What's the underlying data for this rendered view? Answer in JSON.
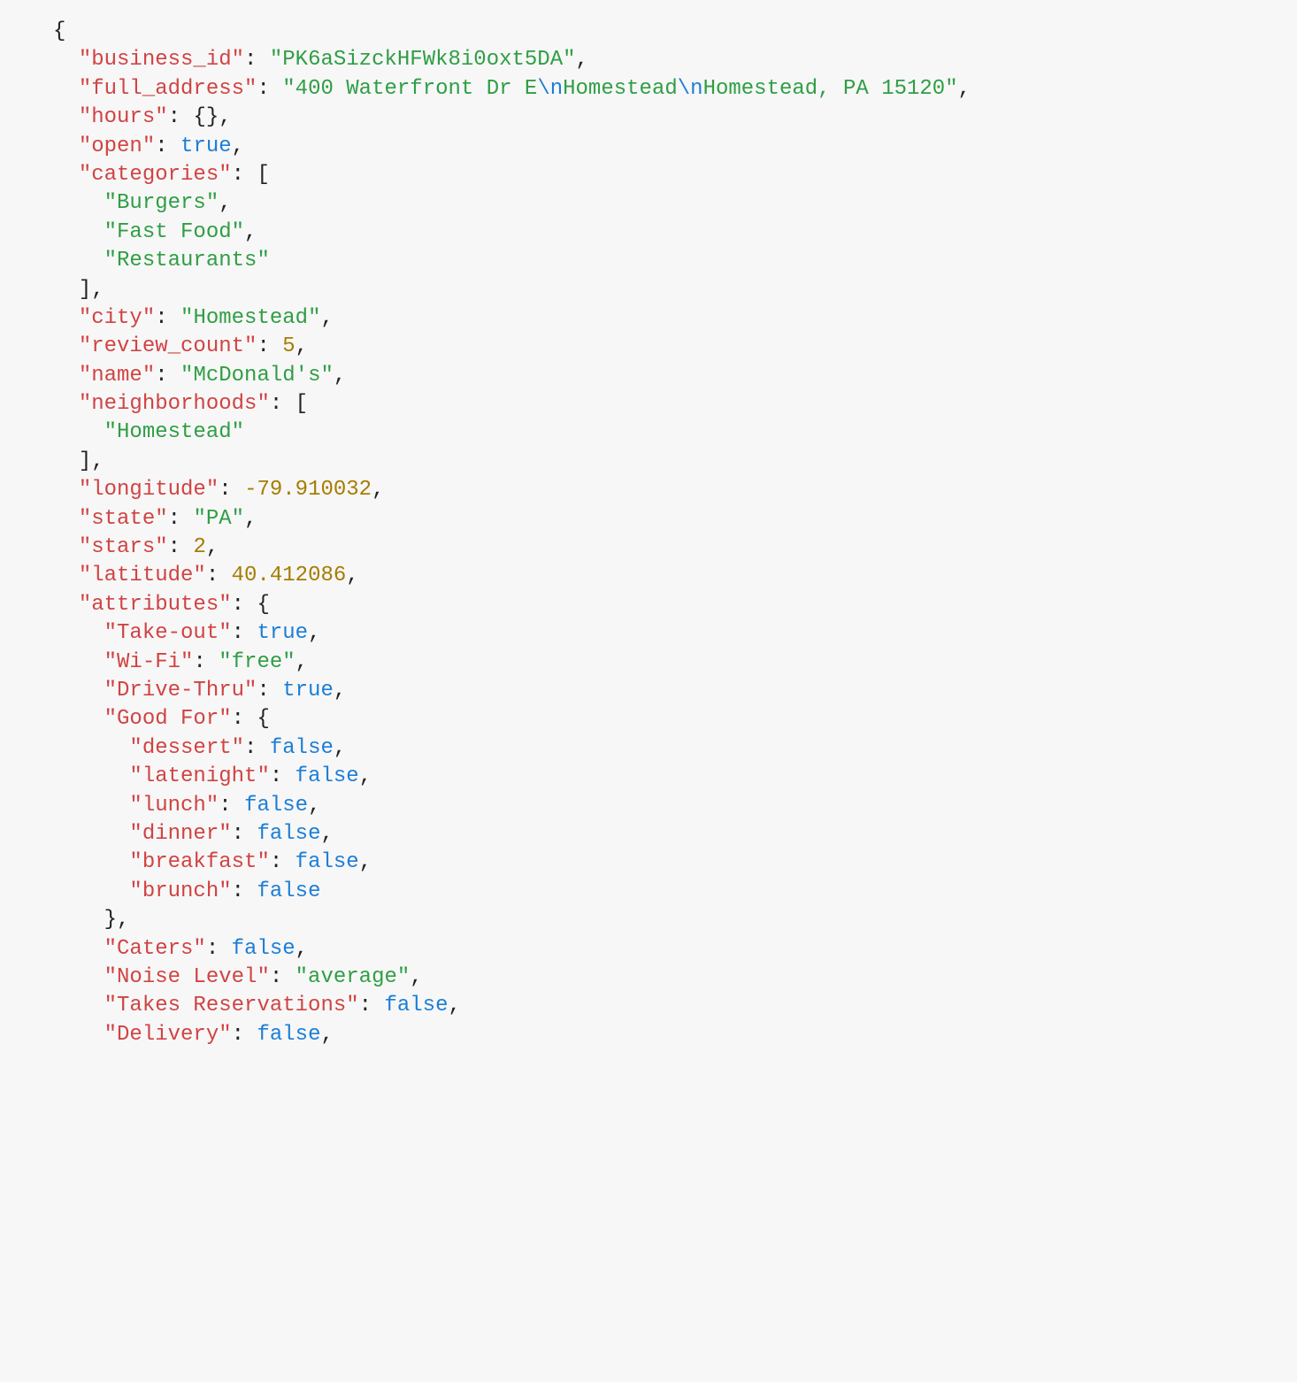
{
  "tokens": [
    {
      "cls": "p",
      "txt": "{"
    },
    {
      "nl": true,
      "indent": 1,
      "cls": "k",
      "txt": "\"business_id\""
    },
    {
      "cls": "p",
      "txt": ": "
    },
    {
      "cls": "s",
      "txt": "\"PK6aSizckHFWk8i0oxt5DA\""
    },
    {
      "cls": "p",
      "txt": ","
    },
    {
      "nl": true,
      "indent": 1,
      "cls": "k",
      "txt": "\"full_address\""
    },
    {
      "cls": "p",
      "txt": ": "
    },
    {
      "cls": "s",
      "txt": "\"400 Waterfront Dr E"
    },
    {
      "cls": "e",
      "txt": "\\n"
    },
    {
      "cls": "s",
      "txt": "Homestead"
    },
    {
      "cls": "e",
      "txt": "\\n"
    },
    {
      "cls": "s",
      "txt": "Homestead, PA 15120\""
    },
    {
      "cls": "p",
      "txt": ","
    },
    {
      "nl": true,
      "indent": 1,
      "cls": "k",
      "txt": "\"hours\""
    },
    {
      "cls": "p",
      "txt": ": {},"
    },
    {
      "nl": true,
      "indent": 1,
      "cls": "k",
      "txt": "\"open\""
    },
    {
      "cls": "p",
      "txt": ": "
    },
    {
      "cls": "b",
      "txt": "true"
    },
    {
      "cls": "p",
      "txt": ","
    },
    {
      "nl": true,
      "indent": 1,
      "cls": "k",
      "txt": "\"categories\""
    },
    {
      "cls": "p",
      "txt": ": ["
    },
    {
      "nl": true,
      "indent": 2,
      "cls": "s",
      "txt": "\"Burgers\""
    },
    {
      "cls": "p",
      "txt": ","
    },
    {
      "nl": true,
      "indent": 2,
      "cls": "s",
      "txt": "\"Fast Food\""
    },
    {
      "cls": "p",
      "txt": ","
    },
    {
      "nl": true,
      "indent": 2,
      "cls": "s",
      "txt": "\"Restaurants\""
    },
    {
      "nl": true,
      "indent": 1,
      "cls": "p",
      "txt": "],"
    },
    {
      "nl": true,
      "indent": 1,
      "cls": "k",
      "txt": "\"city\""
    },
    {
      "cls": "p",
      "txt": ": "
    },
    {
      "cls": "s",
      "txt": "\"Homestead\""
    },
    {
      "cls": "p",
      "txt": ","
    },
    {
      "nl": true,
      "indent": 1,
      "cls": "k",
      "txt": "\"review_count\""
    },
    {
      "cls": "p",
      "txt": ": "
    },
    {
      "cls": "n",
      "txt": "5"
    },
    {
      "cls": "p",
      "txt": ","
    },
    {
      "nl": true,
      "indent": 1,
      "cls": "k",
      "txt": "\"name\""
    },
    {
      "cls": "p",
      "txt": ": "
    },
    {
      "cls": "s",
      "txt": "\"McDonald's\""
    },
    {
      "cls": "p",
      "txt": ","
    },
    {
      "nl": true,
      "indent": 1,
      "cls": "k",
      "txt": "\"neighborhoods\""
    },
    {
      "cls": "p",
      "txt": ": ["
    },
    {
      "nl": true,
      "indent": 2,
      "cls": "s",
      "txt": "\"Homestead\""
    },
    {
      "nl": true,
      "indent": 1,
      "cls": "p",
      "txt": "],"
    },
    {
      "nl": true,
      "indent": 1,
      "cls": "k",
      "txt": "\"longitude\""
    },
    {
      "cls": "p",
      "txt": ": "
    },
    {
      "cls": "n",
      "txt": "-79.910032"
    },
    {
      "cls": "p",
      "txt": ","
    },
    {
      "nl": true,
      "indent": 1,
      "cls": "k",
      "txt": "\"state\""
    },
    {
      "cls": "p",
      "txt": ": "
    },
    {
      "cls": "s",
      "txt": "\"PA\""
    },
    {
      "cls": "p",
      "txt": ","
    },
    {
      "nl": true,
      "indent": 1,
      "cls": "k",
      "txt": "\"stars\""
    },
    {
      "cls": "p",
      "txt": ": "
    },
    {
      "cls": "n",
      "txt": "2"
    },
    {
      "cls": "p",
      "txt": ","
    },
    {
      "nl": true,
      "indent": 1,
      "cls": "k",
      "txt": "\"latitude\""
    },
    {
      "cls": "p",
      "txt": ": "
    },
    {
      "cls": "n",
      "txt": "40.412086"
    },
    {
      "cls": "p",
      "txt": ","
    },
    {
      "nl": true,
      "indent": 1,
      "cls": "k",
      "txt": "\"attributes\""
    },
    {
      "cls": "p",
      "txt": ": {"
    },
    {
      "nl": true,
      "indent": 2,
      "cls": "k",
      "txt": "\"Take-out\""
    },
    {
      "cls": "p",
      "txt": ": "
    },
    {
      "cls": "b",
      "txt": "true"
    },
    {
      "cls": "p",
      "txt": ","
    },
    {
      "nl": true,
      "indent": 2,
      "cls": "k",
      "txt": "\"Wi-Fi\""
    },
    {
      "cls": "p",
      "txt": ": "
    },
    {
      "cls": "s",
      "txt": "\"free\""
    },
    {
      "cls": "p",
      "txt": ","
    },
    {
      "nl": true,
      "indent": 2,
      "cls": "k",
      "txt": "\"Drive-Thru\""
    },
    {
      "cls": "p",
      "txt": ": "
    },
    {
      "cls": "b",
      "txt": "true"
    },
    {
      "cls": "p",
      "txt": ","
    },
    {
      "nl": true,
      "indent": 2,
      "cls": "k",
      "txt": "\"Good For\""
    },
    {
      "cls": "p",
      "txt": ": {"
    },
    {
      "nl": true,
      "indent": 3,
      "cls": "k",
      "txt": "\"dessert\""
    },
    {
      "cls": "p",
      "txt": ": "
    },
    {
      "cls": "b",
      "txt": "false"
    },
    {
      "cls": "p",
      "txt": ","
    },
    {
      "nl": true,
      "indent": 3,
      "cls": "k",
      "txt": "\"latenight\""
    },
    {
      "cls": "p",
      "txt": ": "
    },
    {
      "cls": "b",
      "txt": "false"
    },
    {
      "cls": "p",
      "txt": ","
    },
    {
      "nl": true,
      "indent": 3,
      "cls": "k",
      "txt": "\"lunch\""
    },
    {
      "cls": "p",
      "txt": ": "
    },
    {
      "cls": "b",
      "txt": "false"
    },
    {
      "cls": "p",
      "txt": ","
    },
    {
      "nl": true,
      "indent": 3,
      "cls": "k",
      "txt": "\"dinner\""
    },
    {
      "cls": "p",
      "txt": ": "
    },
    {
      "cls": "b",
      "txt": "false"
    },
    {
      "cls": "p",
      "txt": ","
    },
    {
      "nl": true,
      "indent": 3,
      "cls": "k",
      "txt": "\"breakfast\""
    },
    {
      "cls": "p",
      "txt": ": "
    },
    {
      "cls": "b",
      "txt": "false"
    },
    {
      "cls": "p",
      "txt": ","
    },
    {
      "nl": true,
      "indent": 3,
      "cls": "k",
      "txt": "\"brunch\""
    },
    {
      "cls": "p",
      "txt": ": "
    },
    {
      "cls": "b",
      "txt": "false"
    },
    {
      "nl": true,
      "indent": 2,
      "cls": "p",
      "txt": "},"
    },
    {
      "nl": true,
      "indent": 2,
      "cls": "k",
      "txt": "\"Caters\""
    },
    {
      "cls": "p",
      "txt": ": "
    },
    {
      "cls": "b",
      "txt": "false"
    },
    {
      "cls": "p",
      "txt": ","
    },
    {
      "nl": true,
      "indent": 2,
      "cls": "k",
      "txt": "\"Noise Level\""
    },
    {
      "cls": "p",
      "txt": ": "
    },
    {
      "cls": "s",
      "txt": "\"average\""
    },
    {
      "cls": "p",
      "txt": ","
    },
    {
      "nl": true,
      "indent": 2,
      "cls": "k",
      "txt": "\"Takes Reservations\""
    },
    {
      "cls": "p",
      "txt": ": "
    },
    {
      "cls": "b",
      "txt": "false"
    },
    {
      "cls": "p",
      "txt": ","
    },
    {
      "nl": true,
      "indent": 2,
      "cls": "k",
      "txt": "\"Delivery\""
    },
    {
      "cls": "p",
      "txt": ": "
    },
    {
      "cls": "b",
      "txt": "false"
    },
    {
      "cls": "p",
      "txt": ","
    }
  ],
  "indent_unit": "  "
}
